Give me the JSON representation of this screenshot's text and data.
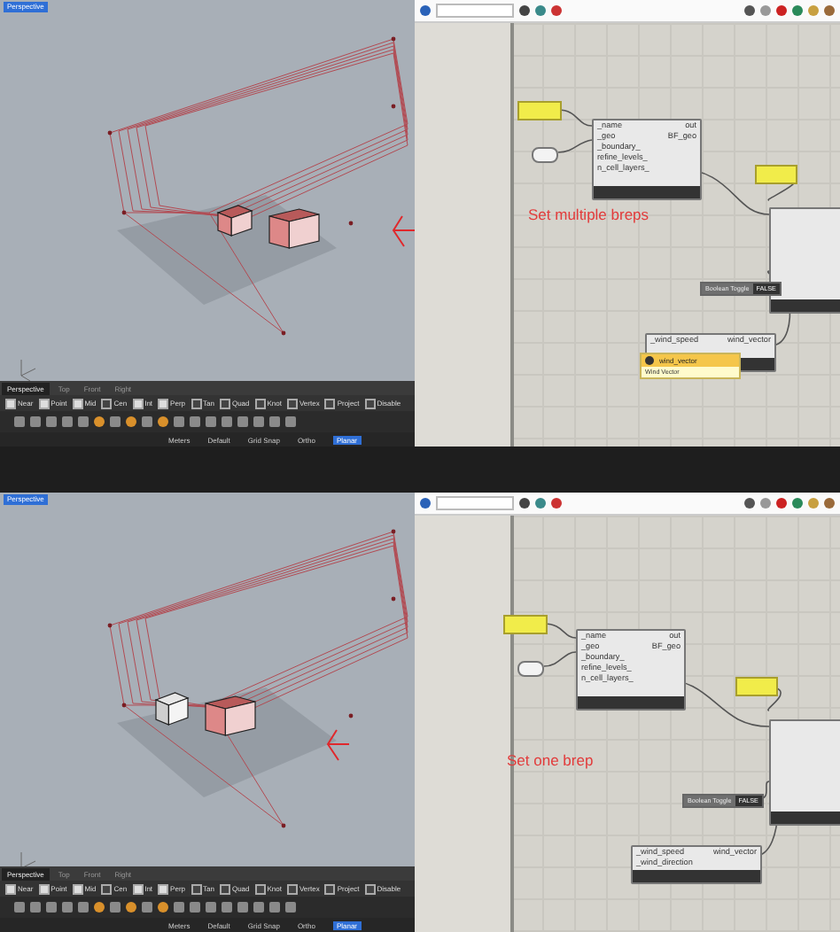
{
  "panels": [
    {
      "rhino": {
        "viewport_label": "Perspective",
        "boxes": [
          {
            "selected": true
          },
          {
            "selected": true
          }
        ],
        "view_tabs": [
          {
            "label": "Perspective",
            "selected": true
          },
          {
            "label": "Top",
            "selected": false
          },
          {
            "label": "Front",
            "selected": false
          },
          {
            "label": "Right",
            "selected": false
          }
        ],
        "osnaps": [
          {
            "label": "Near",
            "checked": true
          },
          {
            "label": "Point",
            "checked": true
          },
          {
            "label": "Mid",
            "checked": true
          },
          {
            "label": "Cen",
            "checked": false
          },
          {
            "label": "Int",
            "checked": true
          },
          {
            "label": "Perp",
            "checked": true
          },
          {
            "label": "Tan",
            "checked": false
          },
          {
            "label": "Quad",
            "checked": false
          },
          {
            "label": "Knot",
            "checked": false
          },
          {
            "label": "Vertex",
            "checked": false
          },
          {
            "label": "Project",
            "checked": false
          },
          {
            "label": "Disable",
            "checked": false
          }
        ],
        "status": [
          "Meters",
          "Default",
          "Grid Snap",
          "Ortho",
          "Planar"
        ]
      },
      "grasshopper": {
        "component": {
          "inputs": [
            "_name",
            "_geo",
            "_boundary_",
            "refine_levels_",
            "n_cell_layers_"
          ],
          "outputs": [
            "out",
            "BF_geo"
          ]
        },
        "toggle": {
          "label": "Boolean Toggle",
          "value": "FALSE"
        },
        "wind": {
          "inputs": [
            "_wind_speed"
          ],
          "output": "wind_vector"
        },
        "tooltip": {
          "title": "wind_vector",
          "subtitle": "Wind Vector"
        },
        "caption": "Set multiple breps"
      }
    },
    {
      "rhino": {
        "viewport_label": "Perspective",
        "boxes": [
          {
            "selected": false
          },
          {
            "selected": true
          }
        ],
        "view_tabs": [
          {
            "label": "Perspective",
            "selected": true
          },
          {
            "label": "Top",
            "selected": false
          },
          {
            "label": "Front",
            "selected": false
          },
          {
            "label": "Right",
            "selected": false
          }
        ],
        "osnaps": [
          {
            "label": "Near",
            "checked": true
          },
          {
            "label": "Point",
            "checked": true
          },
          {
            "label": "Mid",
            "checked": true
          },
          {
            "label": "Cen",
            "checked": false
          },
          {
            "label": "Int",
            "checked": true
          },
          {
            "label": "Perp",
            "checked": true
          },
          {
            "label": "Tan",
            "checked": false
          },
          {
            "label": "Quad",
            "checked": false
          },
          {
            "label": "Knot",
            "checked": false
          },
          {
            "label": "Vertex",
            "checked": false
          },
          {
            "label": "Project",
            "checked": false
          },
          {
            "label": "Disable",
            "checked": false
          }
        ],
        "status": [
          "Meters",
          "Default",
          "Grid Snap",
          "Ortho",
          "Planar"
        ]
      },
      "grasshopper": {
        "component": {
          "inputs": [
            "_name",
            "_geo",
            "_boundary_",
            "refine_levels_",
            "n_cell_layers_"
          ],
          "outputs": [
            "out",
            "BF_geo"
          ]
        },
        "toggle": {
          "label": "Boolean Toggle",
          "value": "FALSE"
        },
        "wind": {
          "inputs": [
            "_wind_speed",
            "_wind_direction"
          ],
          "output": "wind_vector"
        },
        "caption": "Set one brep"
      }
    }
  ]
}
